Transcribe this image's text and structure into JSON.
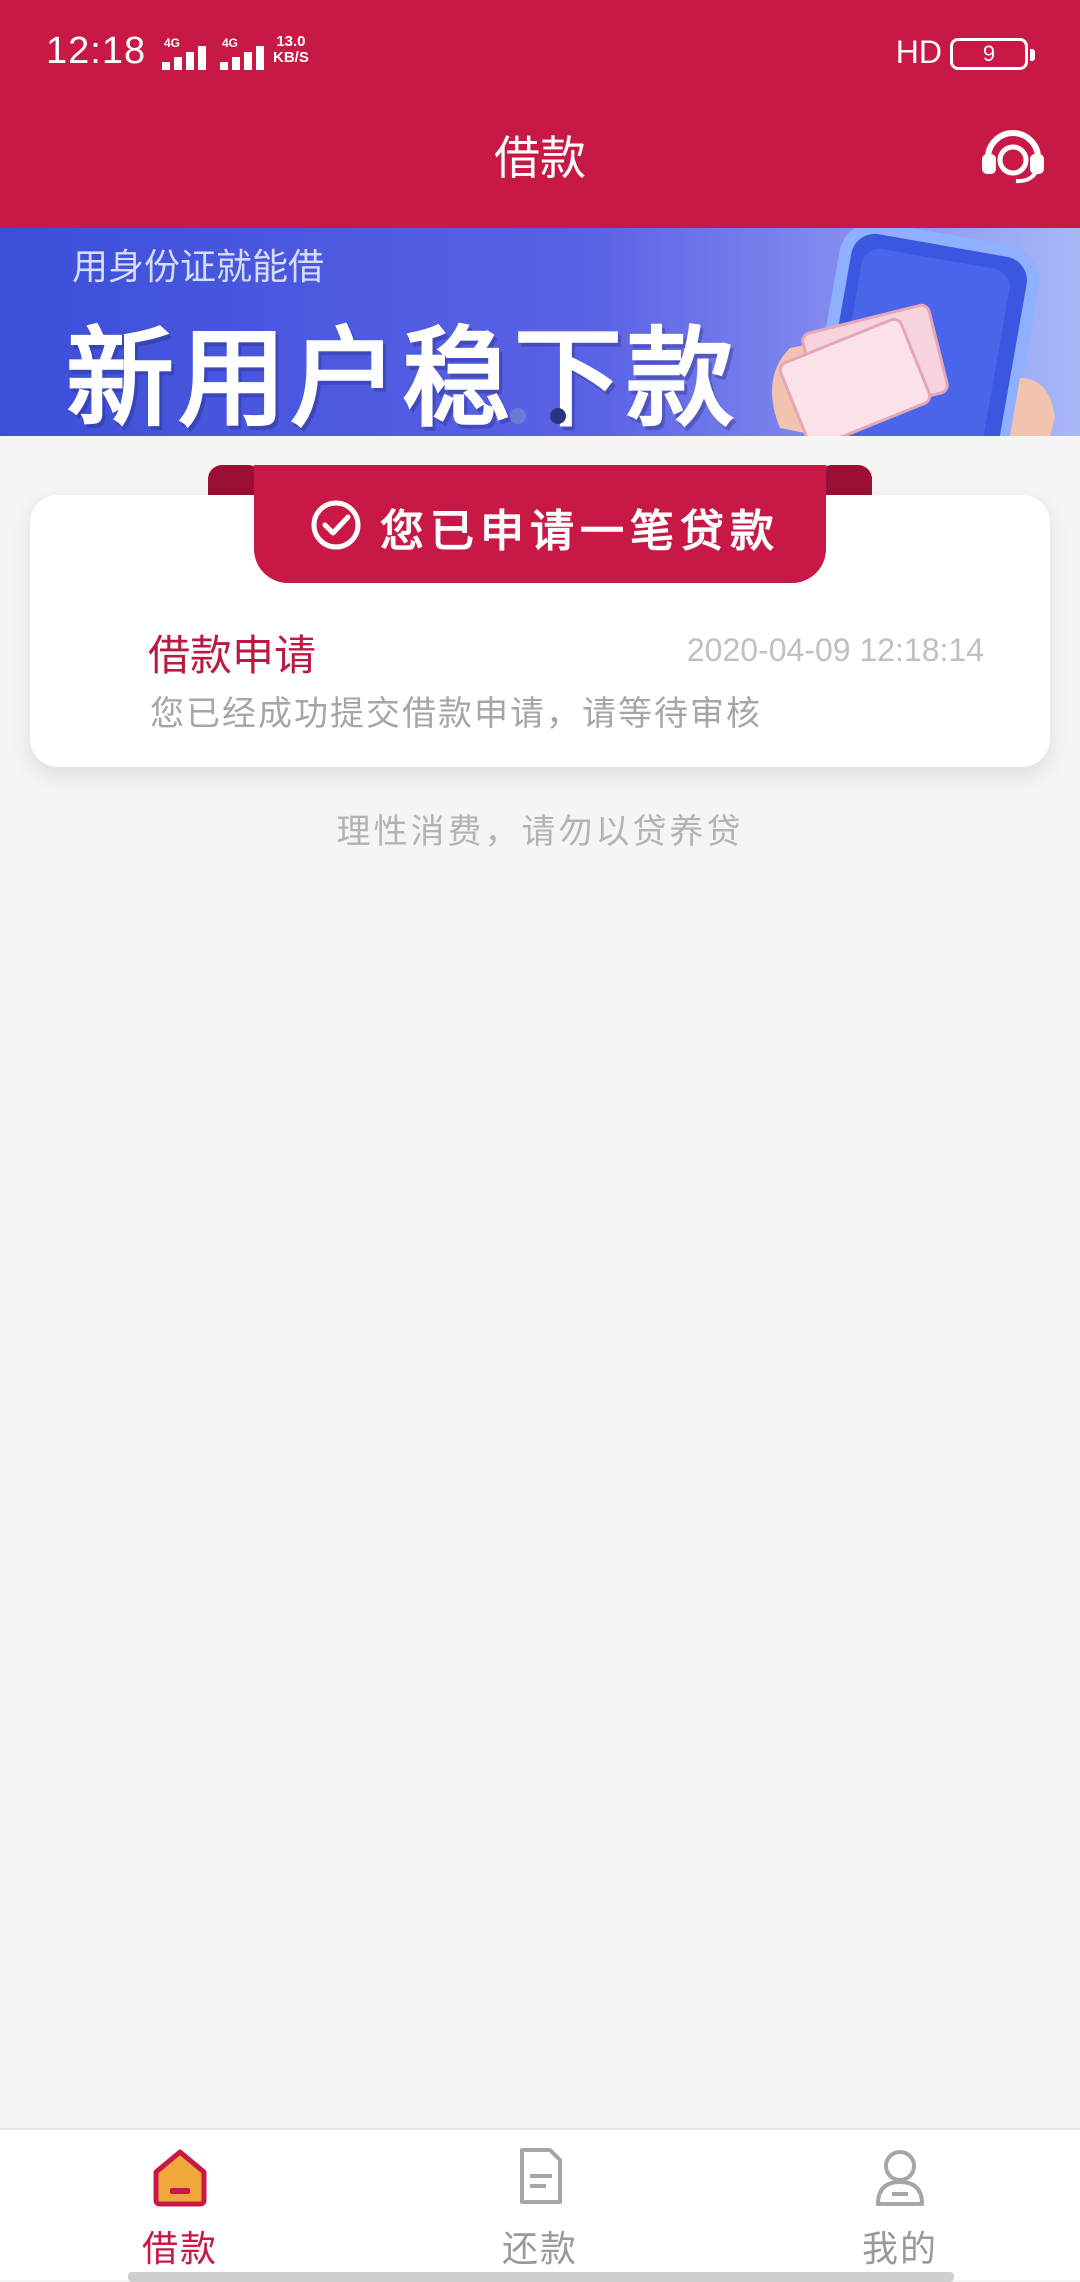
{
  "status_bar": {
    "time": "12:18",
    "network_1": "4G",
    "network_2": "4G",
    "speed_value": "13.0",
    "speed_unit": "KB/S",
    "hd_label": "HD",
    "battery": "9"
  },
  "header": {
    "title": "借款",
    "support_icon": "headset-icon"
  },
  "banner": {
    "subtitle": "用身份证就能借",
    "headline": "新用户稳下款",
    "page_count": 2,
    "active_page": 2
  },
  "card": {
    "ribbon_text": "您已申请一笔贷款",
    "title": "借款申请",
    "timestamp": "2020-04-09 12:18:14",
    "description": "您已经成功提交借款申请，请等待审核"
  },
  "hint": "理性消费，请勿以贷养贷",
  "bottom_nav": {
    "items": [
      {
        "label": "借款",
        "icon": "home-icon",
        "active": true
      },
      {
        "label": "还款",
        "icon": "document-icon",
        "active": false
      },
      {
        "label": "我的",
        "icon": "user-icon",
        "active": false
      }
    ]
  },
  "colors": {
    "brand": "#c81845",
    "inactive": "#9a9a9a",
    "active_icon_fill": "#f0a83a"
  }
}
